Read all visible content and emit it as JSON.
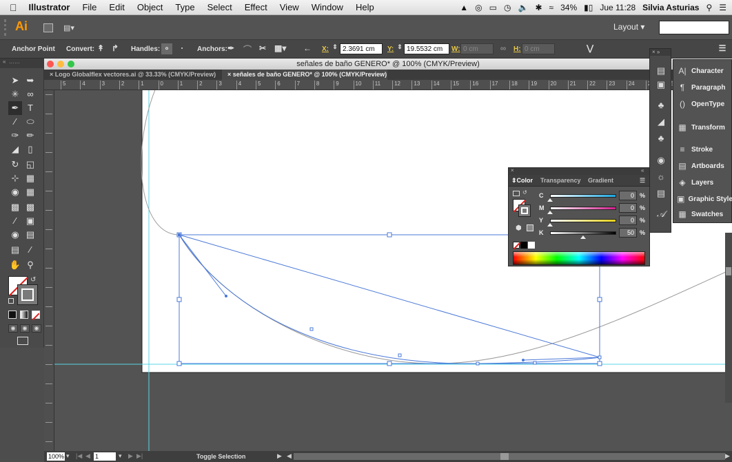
{
  "menubar": {
    "app": "Illustrator",
    "items": [
      "File",
      "Edit",
      "Object",
      "Type",
      "Select",
      "Effect",
      "View",
      "Window",
      "Help"
    ],
    "battery": "34%",
    "clock": "Jue 11:28",
    "user": "Silvia Asturias"
  },
  "appbar": {
    "logo": "Ai",
    "workspace": "Layout"
  },
  "controlbar": {
    "mode": "Anchor Point",
    "convert_label": "Convert:",
    "handles_label": "Handles:",
    "anchors_label": "Anchors:",
    "x_label": "X:",
    "x_value": "2.3691 cm",
    "y_label": "Y:",
    "y_value": "19.5532 cm",
    "w_label": "W:",
    "w_value": "0 cm",
    "h_label": "H:",
    "h_value": "0 cm"
  },
  "document": {
    "title": "señales de baño GENERO* @ 100% (CMYK/Preview)",
    "tabs": [
      "Logo Globalflex vectores.ai @ 33.33% (CMYK/Preview)",
      "señales de baño GENERO* @ 100% (CMYK/Preview)"
    ],
    "ruler_top": [
      "5",
      "4",
      "3",
      "2",
      "1",
      "0",
      "1",
      "2",
      "3",
      "4",
      "5",
      "6",
      "7",
      "8",
      "9",
      "10",
      "11",
      "12",
      "13",
      "14",
      "15",
      "16",
      "17",
      "18",
      "19",
      "20",
      "21",
      "22",
      "23",
      "24",
      "25",
      "26",
      "27",
      "28",
      "29",
      "30",
      "3"
    ],
    "status": {
      "zoom": "100%",
      "page": "1",
      "tool_status": "Toggle Selection"
    }
  },
  "color_panel": {
    "tabs": [
      "Color",
      "Transparency",
      "Gradient"
    ],
    "channels": [
      {
        "name": "C",
        "value": "0",
        "level": 0.0,
        "color": "#1aa7e0"
      },
      {
        "name": "M",
        "value": "0",
        "level": 0.0,
        "color": "#d11e8c"
      },
      {
        "name": "Y",
        "value": "0",
        "level": 0.0,
        "color": "#e7d21a"
      },
      {
        "name": "K",
        "value": "50",
        "level": 0.5,
        "color": "#000000"
      }
    ],
    "pct": "%"
  },
  "panels": [
    {
      "label": "Character",
      "icon": "character-icon"
    },
    {
      "label": "Paragraph",
      "icon": "paragraph-icon"
    },
    {
      "label": "OpenType",
      "icon": "opentype-icon"
    },
    {
      "label": "Transform",
      "icon": "transform-icon"
    },
    {
      "label": "Stroke",
      "icon": "stroke-icon"
    },
    {
      "label": "Artboards",
      "icon": "artboards-icon"
    },
    {
      "label": "Layers",
      "icon": "layers-icon"
    },
    {
      "label": "Graphic Style",
      "icon": "graphic-styles-icon"
    },
    {
      "label": "Swatches",
      "icon": "swatches-icon"
    }
  ],
  "colors": {
    "selection": "#4a78d8",
    "guide": "#59d6e6",
    "accent": "#ff9a00"
  }
}
